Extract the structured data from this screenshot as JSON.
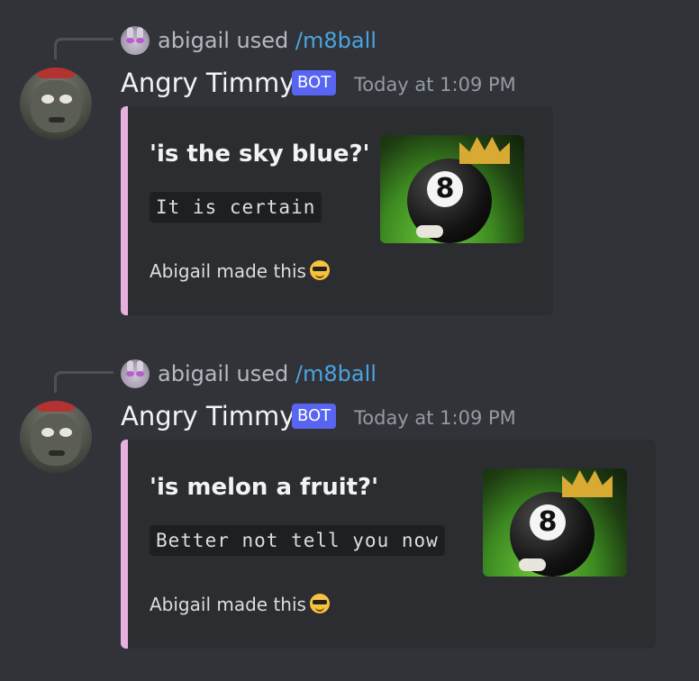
{
  "messages": [
    {
      "reply": {
        "user": "abigail",
        "verb": "used",
        "command": "/m8ball"
      },
      "author": {
        "name": "Angry Timmy",
        "tag": "BOT",
        "timestamp": "Today at 1:09 PM"
      },
      "embed": {
        "accent_color": "#e5b1de",
        "title": "'is the sky blue?'",
        "answer": "It is certain",
        "footer": "Abigail made this",
        "footer_emoji": "sunglasses-emoji",
        "thumbnail": "8-ball-with-crown-image"
      }
    },
    {
      "reply": {
        "user": "abigail",
        "verb": "used",
        "command": "/m8ball"
      },
      "author": {
        "name": "Angry Timmy",
        "tag": "BOT",
        "timestamp": "Today at 1:09 PM"
      },
      "embed": {
        "accent_color": "#e5b1de",
        "title": "'is melon a fruit?'",
        "answer": "Better not tell you now",
        "footer": "Abigail made this",
        "footer_emoji": "sunglasses-emoji",
        "thumbnail": "8-ball-with-crown-image"
      }
    }
  ],
  "colors": {
    "background": "#313338",
    "embed_background": "#2b2d31",
    "bot_tag": "#5865f2",
    "command_link": "#4ca3e0"
  }
}
